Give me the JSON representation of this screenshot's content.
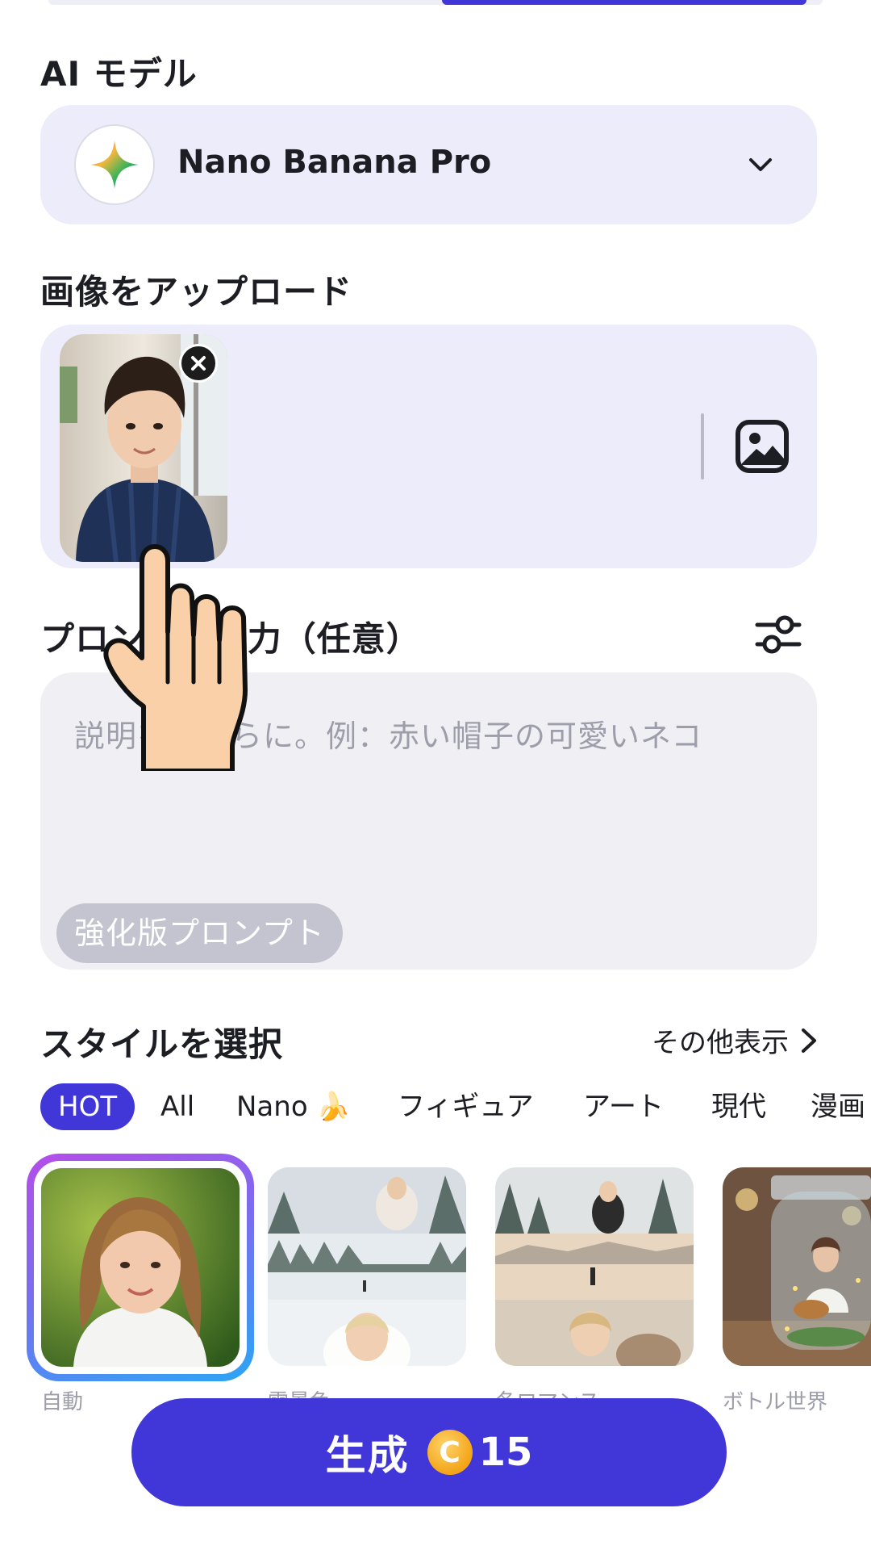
{
  "model_section": {
    "label": "AI モデル",
    "selected_model": "Nano Banana Pro",
    "logo_icon": "sparkle-icon",
    "expand_icon": "chevron-down-icon"
  },
  "upload_section": {
    "label": "画像をアップロード",
    "thumbnail_alt": "アップロード画像",
    "remove_icon": "close-icon",
    "picker_icon": "image-icon"
  },
  "prompt_section": {
    "label": "プロンプト入力（任意）",
    "placeholder": "説明をこちらに。例：赤い帽子の可愛いネコ",
    "enhance_label": "強化版プロンプト",
    "settings_icon": "sliders-icon"
  },
  "style_section": {
    "label": "スタイルを選択",
    "more_label": "その他表示",
    "more_icon": "chevron-right-icon",
    "tabs": [
      "HOT",
      "All",
      "Nano 🍌",
      "フィギュア",
      "アート",
      "現代",
      "漫画"
    ],
    "active_tab": "HOT",
    "cards": [
      {
        "label": "自動",
        "selected": true
      },
      {
        "label": "雪景色",
        "selected": false
      },
      {
        "label": "冬ロマンス",
        "selected": false
      },
      {
        "label": "ボトル世界",
        "selected": false
      }
    ]
  },
  "generate": {
    "label": "生成",
    "coin_symbol": "C",
    "cost": "15"
  },
  "colors": {
    "accent": "#4137d8",
    "panel": "#ececfb",
    "input_bg": "#f0f0f4",
    "muted_text": "#9e9eab"
  }
}
